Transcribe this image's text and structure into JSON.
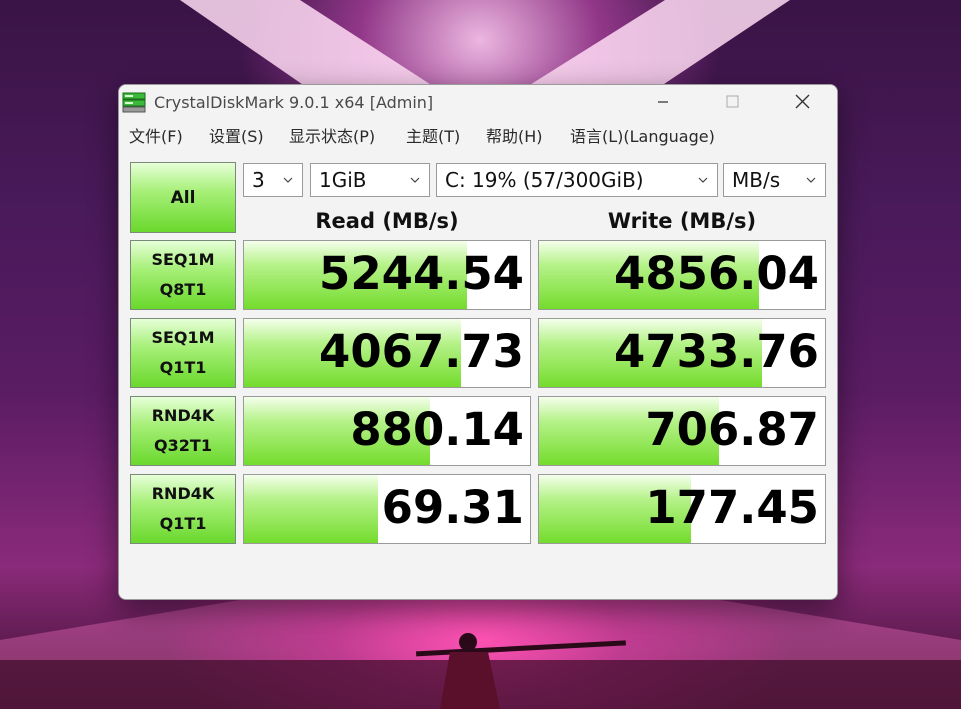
{
  "window": {
    "title": "CrystalDiskMark 9.0.1 x64 [Admin]"
  },
  "menu": {
    "items": [
      "文件(F)",
      "设置(S)",
      "显示状态(P)",
      "主题(T)",
      "帮助(H)",
      "语言(L)(Language)"
    ]
  },
  "controls": {
    "all_label": "All",
    "count": "3",
    "size": "1GiB",
    "drive": "C: 19% (57/300GiB)",
    "unit": "MB/s"
  },
  "headers": {
    "read": "Read (MB/s)",
    "write": "Write (MB/s)"
  },
  "tests": [
    {
      "line1": "SEQ1M",
      "line2": "Q8T1",
      "read": "5244.54",
      "write": "4856.04",
      "read_fill": 0.78,
      "write_fill": 0.77
    },
    {
      "line1": "SEQ1M",
      "line2": "Q1T1",
      "read": "4067.73",
      "write": "4733.76",
      "read_fill": 0.76,
      "write_fill": 0.78
    },
    {
      "line1": "RND4K",
      "line2": "Q32T1",
      "read": "880.14",
      "write": "706.87",
      "read_fill": 0.65,
      "write_fill": 0.63
    },
    {
      "line1": "RND4K",
      "line2": "Q1T1",
      "read": "69.31",
      "write": "177.45",
      "read_fill": 0.47,
      "write_fill": 0.53
    }
  ],
  "status_text": "",
  "colors": {
    "accent_green": "#74dc2c",
    "button_green_top": "#e6ffd8"
  }
}
